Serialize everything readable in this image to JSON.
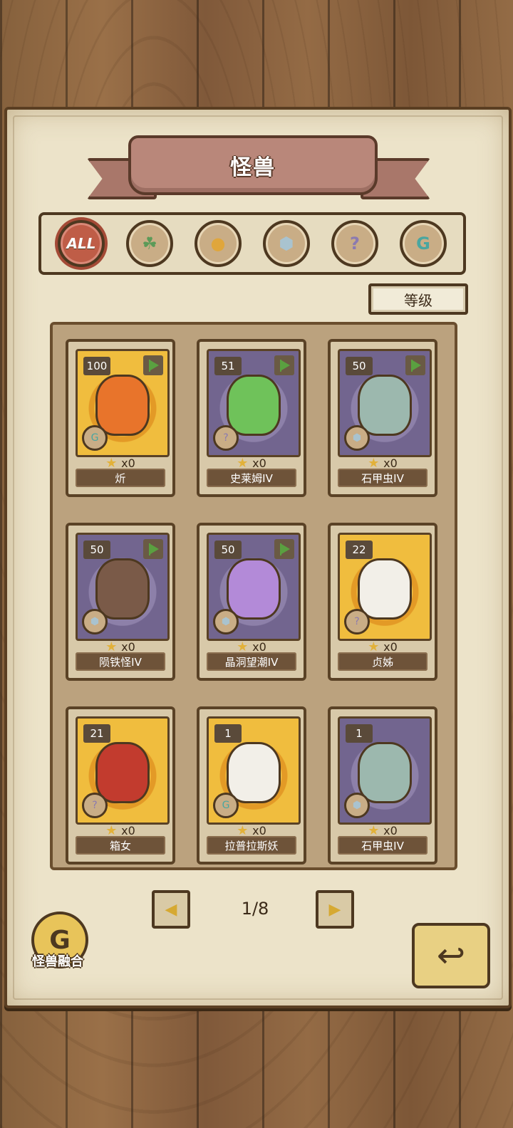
{
  "title": "怪兽",
  "filters": [
    {
      "label": "ALL",
      "icon": "all-icon",
      "active": true
    },
    {
      "label": "",
      "icon": "leaf-icon",
      "active": false
    },
    {
      "label": "",
      "icon": "paw-icon",
      "active": false
    },
    {
      "label": "",
      "icon": "crystal-icon",
      "active": false
    },
    {
      "label": "",
      "icon": "question-icon",
      "active": false
    },
    {
      "label": "",
      "icon": "spiral-icon",
      "active": false
    }
  ],
  "sort_label": "等级",
  "cards": [
    {
      "level": "100",
      "name": "炘",
      "count": "x0",
      "flag": true,
      "bg": "gold",
      "type": "spiral",
      "color": "#e8742b"
    },
    {
      "level": "51",
      "name": "史莱姆IV",
      "count": "x0",
      "flag": true,
      "bg": "purple",
      "type": "question",
      "color": "#6fc25a"
    },
    {
      "level": "50",
      "name": "石甲虫IV",
      "count": "x0",
      "flag": true,
      "bg": "purple",
      "type": "crystal",
      "color": "#9cb8ae"
    },
    {
      "level": "50",
      "name": "陨铁怪IV",
      "count": "x0",
      "flag": true,
      "bg": "purple",
      "type": "crystal",
      "color": "#7a5a48"
    },
    {
      "level": "50",
      "name": "晶洞望潮IV",
      "count": "x0",
      "flag": true,
      "bg": "purple",
      "type": "crystal",
      "color": "#b38ad8"
    },
    {
      "level": "22",
      "name": "贞姊",
      "count": "x0",
      "flag": false,
      "bg": "gold",
      "type": "question",
      "color": "#f2efe8"
    },
    {
      "level": "21",
      "name": "箱女",
      "count": "x0",
      "flag": false,
      "bg": "gold",
      "type": "question",
      "color": "#c23b2e"
    },
    {
      "level": "1",
      "name": "拉普拉斯妖",
      "count": "x0",
      "flag": false,
      "bg": "gold",
      "type": "spiral",
      "color": "#f2efe8"
    },
    {
      "level": "1",
      "name": "石甲虫IV",
      "count": "x0",
      "flag": false,
      "bg": "purple",
      "type": "crystal",
      "color": "#9cb8ae"
    }
  ],
  "pagination": {
    "label": "1/8"
  },
  "fuse_label": "怪兽融合"
}
